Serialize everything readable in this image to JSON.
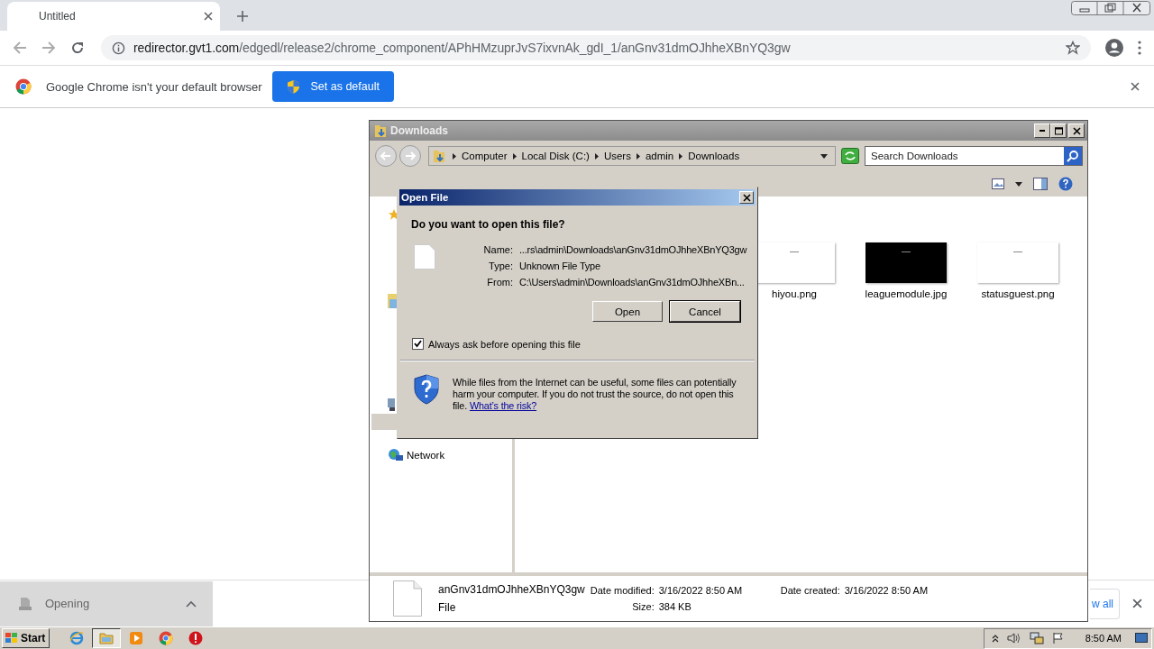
{
  "browser": {
    "tab": {
      "title": "Untitled"
    },
    "url": {
      "host": "redirector.gvt1.com",
      "path": "/edgedl/release2/chrome_component/APhHMzuprJvS7ixvnAk_gdI_1/anGnv31dmOJhheXBnYQ3gw"
    },
    "infobar": {
      "message": "Google Chrome isn't your default browser",
      "button": "Set as default"
    }
  },
  "explorer": {
    "title": "Downloads",
    "breadcrumb": [
      "Computer",
      "Local Disk (C:)",
      "Users",
      "admin",
      "Downloads"
    ],
    "search": {
      "placeholder": "Search Downloads"
    },
    "nav_items": [
      {
        "label": "Network",
        "selected": false
      }
    ],
    "files": [
      {
        "name": "hiyou.png",
        "kind": "light"
      },
      {
        "name": "leaguemodule.jpg",
        "kind": "dark"
      },
      {
        "name": "statusguest.png",
        "kind": "light"
      }
    ],
    "details": {
      "name": "anGnv31dmOJhheXBnYQ3gw",
      "type": "File",
      "fields": [
        {
          "label": "Date modified:",
          "value": "3/16/2022 8:50 AM"
        },
        {
          "label": "Date created:",
          "value": "3/16/2022 8:50 AM"
        },
        {
          "label": "Size:",
          "value": "384 KB"
        }
      ]
    }
  },
  "dialog": {
    "title": "Open File",
    "question": "Do you want to open this file?",
    "fields": [
      {
        "label": "Name:",
        "value": "...rs\\admin\\Downloads\\anGnv31dmOJhheXBnYQ3gw"
      },
      {
        "label": "Type:",
        "value": "Unknown File Type"
      },
      {
        "label": "From:",
        "value": "C:\\Users\\admin\\Downloads\\anGnv31dmOJhheXBn..."
      }
    ],
    "buttons": [
      {
        "label": "Open",
        "default": false
      },
      {
        "label": "Cancel",
        "default": true
      }
    ],
    "checkbox": {
      "label": "Always ask before opening this file",
      "checked": true
    },
    "warning": {
      "text": "While files from the Internet can be useful, some files can potentially harm your computer. If you do not trust the source, do not open this file.",
      "link": "What’s the risk?"
    }
  },
  "downloads_bar": {
    "item": {
      "label": "Opening"
    },
    "partial_button": "w all"
  },
  "taskbar": {
    "start": "Start",
    "apps": [
      {
        "kind": "ie",
        "selected": false
      },
      {
        "kind": "folder",
        "selected": true
      },
      {
        "kind": "media",
        "selected": false
      },
      {
        "kind": "chrome",
        "selected": false
      },
      {
        "kind": "stop",
        "selected": false
      }
    ],
    "clock": "8:50 AM"
  }
}
